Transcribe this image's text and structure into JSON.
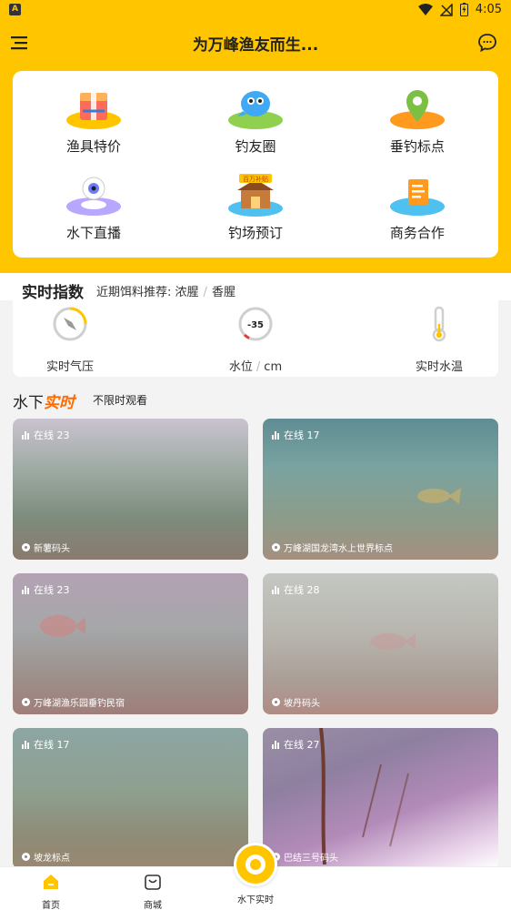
{
  "status_bar": {
    "time": "4:05",
    "app_badge": "A"
  },
  "header": {
    "title": "为万峰渔友而生...",
    "menu_icon": "menu-icon",
    "chat_icon": "chat-bubble-icon"
  },
  "grid": [
    {
      "label": "渔具特价",
      "icon": "gift-box-icon"
    },
    {
      "label": "钓友圈",
      "icon": "chat-bird-icon"
    },
    {
      "label": "垂钓标点",
      "icon": "location-pin-icon"
    },
    {
      "label": "水下直播",
      "icon": "webcam-icon"
    },
    {
      "label": "钓场预订",
      "icon": "house-icon"
    },
    {
      "label": "商务合作",
      "icon": "document-icon"
    }
  ],
  "grid_badge": "百万补贴",
  "index": {
    "title": "实时指数",
    "bait_label": "近期饵料推荐:",
    "bait_a": "浓腥",
    "bait_sep": "/",
    "bait_b": "香腥",
    "pressure_label": "实时气压",
    "water_level_value": "-35",
    "water_level_label": "水位",
    "water_level_unit": "cm",
    "water_level_sep": "/",
    "water_temp_label": "实时水温"
  },
  "underwater": {
    "title_a": "水下",
    "title_b": "实时",
    "subtitle": "不限时观看"
  },
  "videos": [
    {
      "online": "在线 23",
      "location": "新薯码头"
    },
    {
      "online": "在线 17",
      "location": "万峰湖国龙湾水上世界标点"
    },
    {
      "online": "在线 23",
      "location": "万峰湖渔乐园垂钓民宿"
    },
    {
      "online": "在线 28",
      "location": "坡丹码头"
    },
    {
      "online": "在线 17",
      "location": "坡龙标点"
    },
    {
      "online": "在线 27",
      "location": "巴结三号码头"
    }
  ],
  "bottom_nav": {
    "home": "首页",
    "mall": "商城",
    "underwater": "水下实时"
  },
  "colors": {
    "brand_yellow": "#ffc600",
    "accent_orange": "#ff6a00"
  }
}
